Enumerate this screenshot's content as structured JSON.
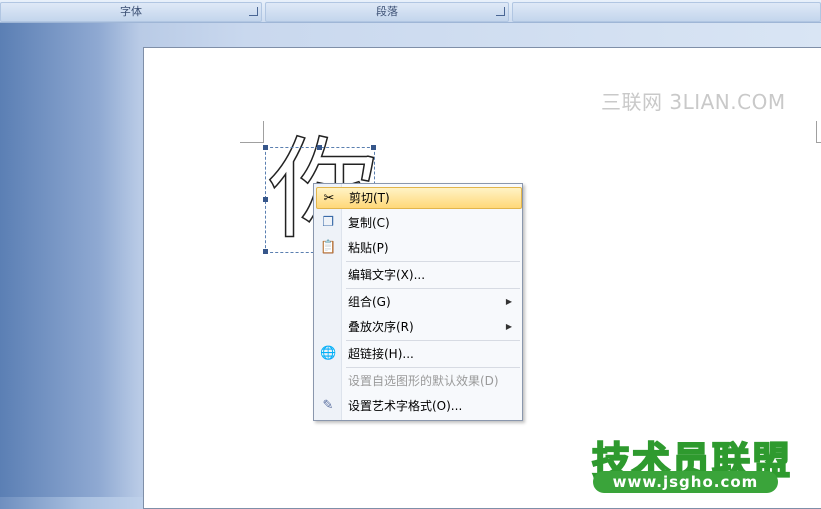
{
  "ribbon": {
    "groups": [
      {
        "label": "字体"
      },
      {
        "label": "段落"
      }
    ]
  },
  "watermark": "三联网 3LIAN.COM",
  "wordart": {
    "text": "你"
  },
  "context_menu": {
    "items": [
      {
        "label": "剪切(T)",
        "icon": "scissors-icon"
      },
      {
        "label": "复制(C)",
        "icon": "copy-icon"
      },
      {
        "label": "粘贴(P)",
        "icon": "paste-icon"
      },
      {
        "label": "编辑文字(X)..."
      },
      {
        "label": "组合(G)"
      },
      {
        "label": "叠放次序(R)"
      },
      {
        "label": "超链接(H)...",
        "icon": "hyperlink-globe-icon"
      },
      {
        "label": "设置自选图形的默认效果(D)"
      },
      {
        "label": "设置艺术字格式(O)...",
        "icon": "wordart-format-icon"
      }
    ],
    "highlight_color": "#ffd879"
  },
  "site_logo": {
    "text": "技术员联盟",
    "url": "www.jsgho.com"
  }
}
